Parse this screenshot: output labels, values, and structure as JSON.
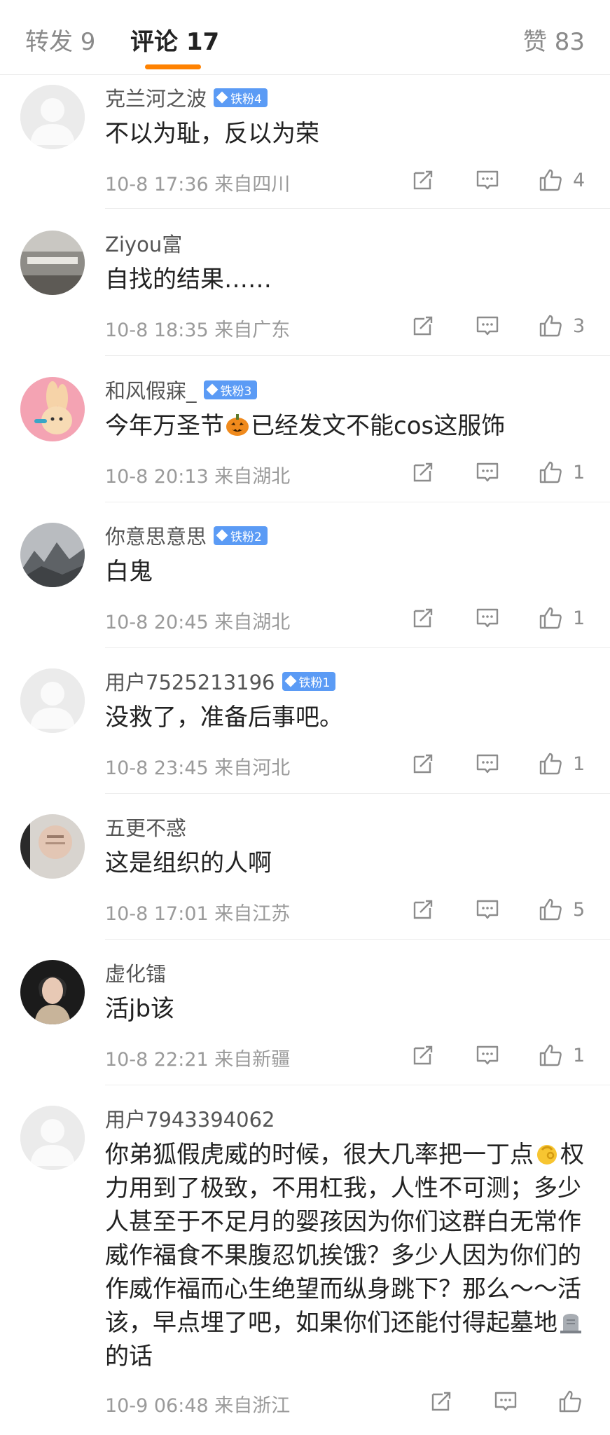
{
  "tabs": {
    "repost": "转发 9",
    "comments": "评论 17",
    "likes": "赞 83"
  },
  "comments": [
    {
      "name": "克兰河之波",
      "badge": "铁粉4",
      "text": "不以为耻，反以为荣",
      "time": "10-8 17:36",
      "location": "来自四川",
      "likes": "4"
    },
    {
      "name": "Ziyou富",
      "badge": "",
      "text": "自找的结果……",
      "time": "10-8 18:35",
      "location": "来自广东",
      "likes": "3"
    },
    {
      "name": "和风假寐_",
      "badge": "铁粉3",
      "text_before": "今年万圣节",
      "text_after": "已经发文不能cos这服饰",
      "emoji": "pumpkin-icon",
      "time": "10-8 20:13",
      "location": "来自湖北",
      "likes": "1"
    },
    {
      "name": "你意思意思",
      "badge": "铁粉2",
      "text": "白鬼",
      "time": "10-8 20:45",
      "location": "来自湖北",
      "likes": "1"
    },
    {
      "name": "用户7525213196",
      "badge": "铁粉1",
      "text": "没救了，准备后事吧。",
      "time": "10-8 23:45",
      "location": "来自河北",
      "likes": "1"
    },
    {
      "name": "五更不惑",
      "badge": "",
      "text": "这是组织的人啊",
      "time": "10-8 17:01",
      "location": "来自江苏",
      "likes": "5"
    },
    {
      "name": "虚化镭",
      "badge": "",
      "text": "活jb该",
      "time": "10-8 22:21",
      "location": "来自新疆",
      "likes": "1"
    },
    {
      "name": "用户7943394062",
      "badge": "",
      "text_part1": "你弟狐假虎威的时候，很大几率把一丁点",
      "text_part2": "权力用到了极致，不用杠我，人性不可测；多少人甚至于不足月的婴孩因为你们这群白无常作威作福食不果腹忍饥挨饿？多少人因为你们的作威作福而心生绝望而纵身跳下？那么～～活该，早点埋了吧，如果你们还能付得起墓地",
      "text_part3": "的话",
      "emoji1": "pinching-hand-icon",
      "emoji2": "headstone-icon",
      "time": "10-9 06:48",
      "location": "来自浙江",
      "likes": ""
    }
  ],
  "colors": {
    "accent": "#ff8200",
    "badge": "#5b9bf5"
  }
}
